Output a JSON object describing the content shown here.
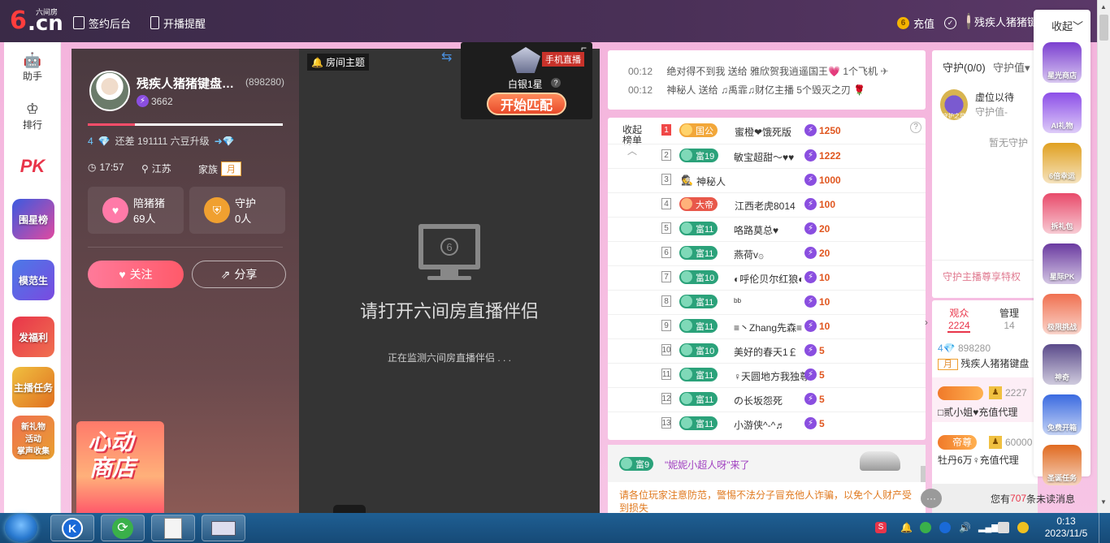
{
  "header": {
    "logo_text": "6.cn",
    "logo_tag": "六间房",
    "sign_backend": "签约后台",
    "live_reminder": "开播提醒",
    "recharge": "充值",
    "username": "残疾人猪猪键盘",
    "collapse": "收起"
  },
  "left_nav": {
    "assistant": "助手",
    "ranking": "排行",
    "pk": "PK",
    "group_star": "围星榜",
    "model_student": "模范生",
    "welfare": "发福利",
    "anchor_task": "主播任务",
    "new_gift_line1": "新礼物",
    "new_gift_line2": "活动",
    "new_gift_line3": "掌声收集"
  },
  "anchor": {
    "name": "残疾人猪猪键盘…",
    "id": "(898280)",
    "beans": "3662",
    "upgrade_prefix": "4",
    "upgrade_text": "还差 191111 六豆升级",
    "time": "17:57",
    "location": "江苏",
    "family_label": "家族",
    "family_value": "月",
    "fans_label": "陪猪猪",
    "fans_count": "69人",
    "guard_label": "守护",
    "guard_count": "0人",
    "follow": "关注",
    "share": "分享",
    "promo_line1": "心动",
    "promo_line2": "商店"
  },
  "video": {
    "room_topic": "房间主题",
    "main_text": "请打开六间房直播伴侣",
    "sub_text": "正在监测六间房直播伴侣 . . .",
    "monitor_glyph": "6"
  },
  "popup": {
    "rank": "白银1星",
    "help": "?",
    "match_button": "开始匹配",
    "mobile_live": "手机直播"
  },
  "ticker": [
    {
      "time": "00:12",
      "text": "绝对得不到我 送给 雅欣贺我逍遥国王💗 1个飞机"
    },
    {
      "time": "00:12",
      "text": "神秘人 送给 ♫禹霏♫财亿主播 5个毁灭之刃"
    }
  ],
  "rank_list": {
    "collapse_line1": "收起",
    "collapse_line2": "榜单",
    "help": "?",
    "rows": [
      {
        "num": "1",
        "level": "国公",
        "style": "gold",
        "name": "蜜橙❤饿死版",
        "score": "1250"
      },
      {
        "num": "2",
        "level": "富19",
        "style": "green",
        "name": "敏宝超甜～♥♥",
        "score": "1222"
      },
      {
        "num": "3",
        "level": "",
        "style": "none",
        "name": "神秘人",
        "score": "1000"
      },
      {
        "num": "4",
        "level": "大帝",
        "style": "red",
        "name": "江西老虎8014",
        "score": "100"
      },
      {
        "num": "5",
        "level": "富11",
        "style": "green",
        "name": "咯路莫总♥",
        "score": "20"
      },
      {
        "num": "6",
        "level": "富11",
        "style": "green",
        "name": "燕荷v۞",
        "score": "20"
      },
      {
        "num": "7",
        "level": "富10",
        "style": "green",
        "name": "◐呼伦贝尔红狼◐",
        "score": "10"
      },
      {
        "num": "8",
        "level": "富11",
        "style": "green",
        "name": "ᵇᵇ",
        "score": "10"
      },
      {
        "num": "9",
        "level": "富11",
        "style": "green",
        "name": "≡丶Zhang先森≡",
        "score": "10"
      },
      {
        "num": "10",
        "level": "富10",
        "style": "green",
        "name": "美好的春天1￡",
        "score": "5"
      },
      {
        "num": "11",
        "level": "富11",
        "style": "green",
        "name": "♀天圆地方我独尊",
        "score": "5"
      },
      {
        "num": "12",
        "level": "富11",
        "style": "green",
        "name": "の长坂怨死",
        "score": "5"
      },
      {
        "num": "13",
        "level": "富11",
        "style": "green",
        "name": "小游侠^-^♬",
        "score": "5"
      }
    ]
  },
  "chat": {
    "join_level": "富9",
    "join_text": "\"妮妮小超人呀\"来了",
    "notice": "请各位玩家注意防范，警惕不法分子冒充他人诈骗，以免个人财产受到损失"
  },
  "guard": {
    "title": "守护(0/0)",
    "guard_value_tab": "守护值▾",
    "vacancy": "虚位以待",
    "guard_value": "守护值-",
    "none": "暂无守护",
    "privilege": "守护主播尊享特权",
    "badge_label": "守护之星"
  },
  "audience": {
    "viewers_label": "观众",
    "viewers_count": "2224",
    "admin_label": "管理",
    "admin_count": "14",
    "entries": [
      {
        "level": "4",
        "id": "898280",
        "family": "月",
        "name": "残疾人猪猪键盘"
      },
      {
        "badge": "2227",
        "name": "□贰小姐♥充值代理"
      },
      {
        "badge_label": "帝尊",
        "badge": "60000",
        "name": "牡丹6万♀充值代理"
      }
    ],
    "unread_prefix": "您有",
    "unread_count": "707",
    "unread_suffix": "条未读消息"
  },
  "activity": [
    {
      "label": "星光商店",
      "color": "#7b3fd0"
    },
    {
      "label": "AI礼物",
      "color": "#8c4ee8"
    },
    {
      "label": "6倍幸运",
      "color": "#e0a020"
    },
    {
      "label": "拆礼包",
      "color": "#e84a6a"
    },
    {
      "label": "星际PK",
      "color": "#6a3aa0"
    },
    {
      "label": "极限挑战",
      "color": "#f07050"
    },
    {
      "label": "神奇",
      "color": "#5a4a8a"
    },
    {
      "label": "免费开箱",
      "color": "#3a6ae0"
    },
    {
      "label": "圣诞任务",
      "color": "#e06a20"
    }
  ],
  "taskbar": {
    "time": "0:13",
    "date": "2023/11/5"
  }
}
